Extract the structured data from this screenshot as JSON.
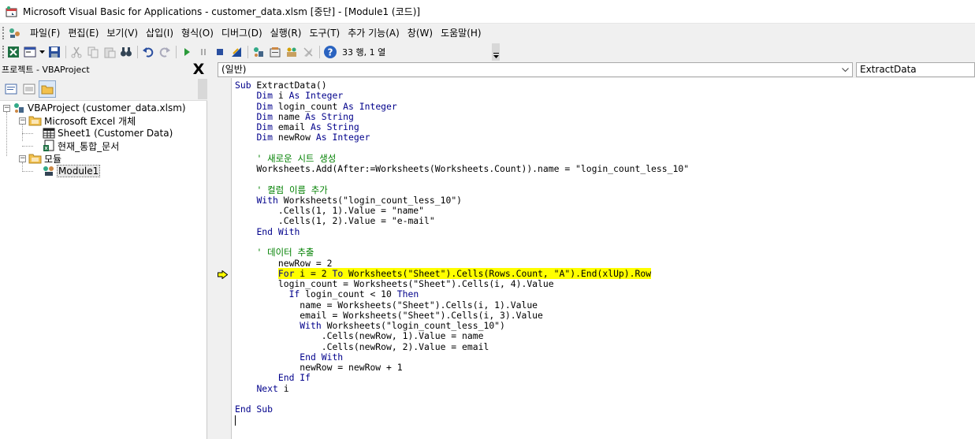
{
  "window": {
    "title": "Microsoft Visual Basic for Applications - customer_data.xlsm [중단] - [Module1 (코드)]"
  },
  "menu": {
    "items": [
      "파일(F)",
      "편집(E)",
      "보기(V)",
      "삽입(I)",
      "형식(O)",
      "디버그(D)",
      "실행(R)",
      "도구(T)",
      "추가 기능(A)",
      "창(W)",
      "도움말(H)"
    ]
  },
  "toolbar": {
    "icons": [
      "excel-view-icon",
      "insert-userform-icon",
      "dropdown-arrow-icon",
      "save-icon",
      "cut-icon",
      "copy-icon",
      "paste-icon",
      "find-icon",
      "undo-icon",
      "redo-icon",
      "run-icon",
      "break-icon",
      "reset-icon",
      "design-mode-icon",
      "project-explorer-icon",
      "properties-icon",
      "object-browser-icon",
      "toolbox-icon",
      "help-icon"
    ],
    "position": "33 행, 1 열"
  },
  "project": {
    "title": "프로젝트 - VBAProject",
    "close_label": "X",
    "tree": [
      {
        "label": "VBAProject (customer_data.xlsm)",
        "icon": "vbaproject-icon",
        "level": 0
      },
      {
        "label": "Microsoft Excel 개체",
        "icon": "folder-icon",
        "level": 1
      },
      {
        "label": "Sheet1 (Customer Data)",
        "icon": "worksheet-icon",
        "level": 2
      },
      {
        "label": "현재_통합_문서",
        "icon": "workbook-icon",
        "level": 2
      },
      {
        "label": "모듈",
        "icon": "folder-icon",
        "level": 1
      },
      {
        "label": "Module1",
        "icon": "module-icon",
        "level": 2,
        "selected": true
      }
    ]
  },
  "code": {
    "object_combo": "(일반)",
    "proc_combo": "ExtractData",
    "lines": [
      "Sub ExtractData()",
      "    Dim i As Integer",
      "    Dim login_count As Integer",
      "    Dim name As String",
      "    Dim email As String",
      "    Dim newRow As Integer",
      "",
      "    ' 새로운 시트 생성",
      "    Worksheets.Add(After:=Worksheets(Worksheets.Count)).name = \"login_count_less_10\"",
      "",
      "    ' 컬럼 이름 추가",
      "    With Worksheets(\"login_count_less_10\")",
      "        .Cells(1, 1).Value = \"name\"",
      "        .Cells(1, 2).Value = \"e-mail\"",
      "    End With",
      "",
      "    ' 데이터 추출",
      "        newRow = 2",
      "        For i = 2 To Worksheets(\"Sheet\").Cells(Rows.Count, \"A\").End(xlUp).Row",
      "        login_count = Worksheets(\"Sheet\").Cells(i, 4).Value",
      "          If login_count < 10 Then",
      "            name = Worksheets(\"Sheet\").Cells(i, 1).Value",
      "            email = Worksheets(\"Sheet\").Cells(i, 3).Value",
      "            With Worksheets(\"login_count_less_10\")",
      "                .Cells(newRow, 1).Value = name",
      "                .Cells(newRow, 2).Value = email",
      "            End With",
      "            newRow = newRow + 1",
      "        End If",
      "    Next i",
      "",
      "End Sub"
    ],
    "highlight_line": 18,
    "caret_line": 32,
    "colors": {
      "keyword": "#00008b",
      "comment": "#008000",
      "highlight": "#ffff00"
    }
  }
}
